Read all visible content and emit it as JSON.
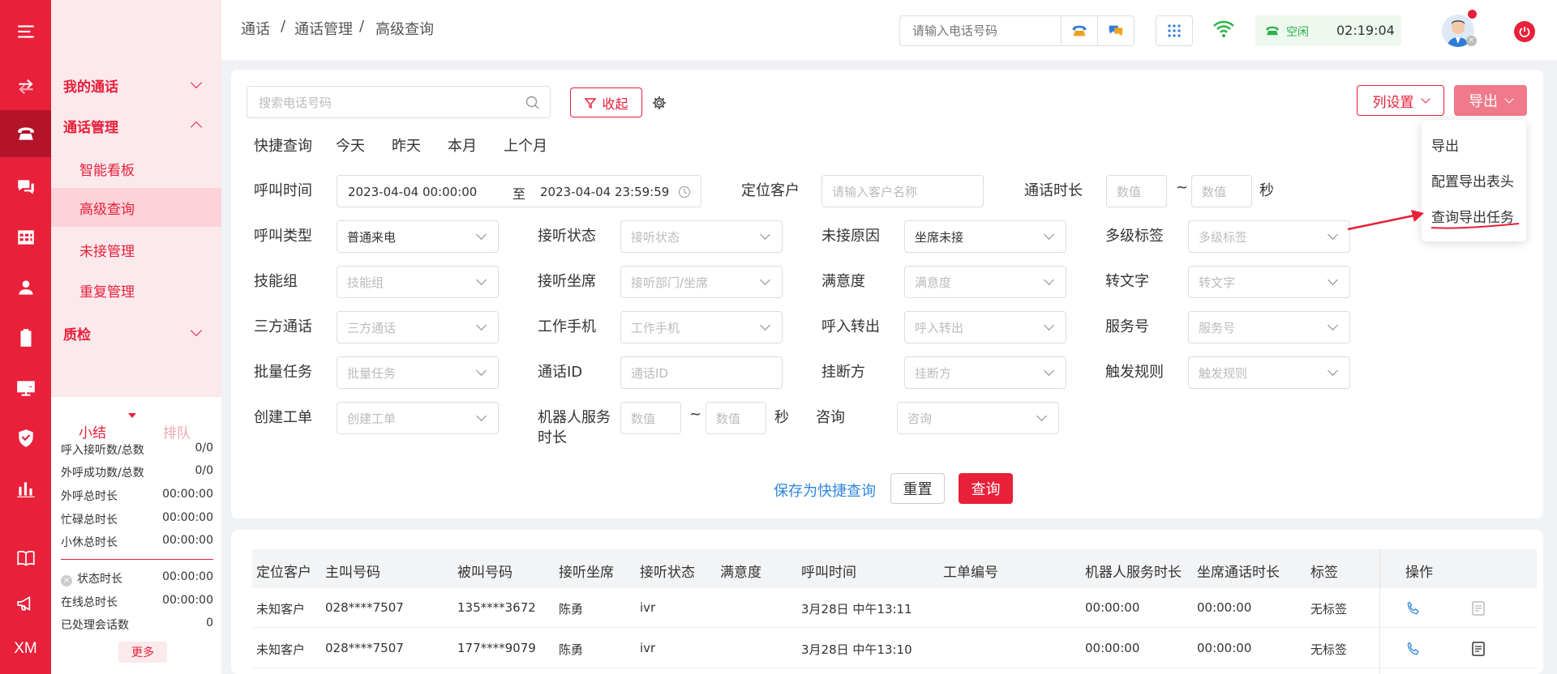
{
  "app": {
    "accent": "#e8203a"
  },
  "rail": {
    "bottom_text": "XM"
  },
  "menu": {
    "groups": [
      {
        "label": "我的通话"
      },
      {
        "label": "通话管理"
      },
      {
        "label": "质检"
      }
    ],
    "subs": [
      {
        "label": "智能看板"
      },
      {
        "label": "高级查询"
      },
      {
        "label": "未接管理"
      },
      {
        "label": "重复管理"
      }
    ]
  },
  "summary": {
    "tabs": [
      "小结",
      "排队"
    ],
    "rows": [
      {
        "label": "呼入接听数/总数",
        "value": "0/0"
      },
      {
        "label": "外呼成功数/总数",
        "value": "0/0"
      },
      {
        "label": "外呼总时长",
        "value": "00:00:00"
      },
      {
        "label": "忙碌总时长",
        "value": "00:00:00"
      },
      {
        "label": "小休总时长",
        "value": "00:00:00"
      },
      {
        "label": "状态时长",
        "value": "00:00:00"
      },
      {
        "label": "在线总时长",
        "value": "00:00:00"
      },
      {
        "label": "已处理会话数",
        "value": "0"
      }
    ],
    "more": "更多"
  },
  "header": {
    "breadcrumb": [
      "通话",
      "/",
      "通话管理",
      "/",
      "高级查询"
    ],
    "phone_placeholder": "请输入电话号码",
    "status_label": "空闲",
    "status_time": "02:19:04"
  },
  "filter": {
    "search_placeholder": "搜索电话号码",
    "collapse_label": "收起",
    "column_settings": "列设置",
    "export": "导出",
    "quick_label": "快捷查询",
    "quick_items": [
      "今天",
      "昨天",
      "本月",
      "上个月"
    ],
    "call_time_label": "呼叫时间",
    "date_from": "2023-04-04 00:00:00",
    "date_to_word": "至",
    "date_to": "2023-04-04 23:59:59",
    "locate_customer_label": "定位客户",
    "locate_customer_placeholder": "请输入客户名称",
    "duration_label": "通话时长",
    "num_placeholder": "数值",
    "tilde": "~",
    "sec": "秒",
    "fields": [
      {
        "label": "呼叫类型",
        "value": "普通来电",
        "has": true
      },
      {
        "label": "接听状态",
        "value": "接听状态"
      },
      {
        "label": "未接原因",
        "value": "坐席未接",
        "has": true
      },
      {
        "label": "多级标签",
        "value": "多级标签"
      },
      {
        "label": "技能组",
        "value": "技能组"
      },
      {
        "label": "接听坐席",
        "value": "接听部门/坐席"
      },
      {
        "label": "满意度",
        "value": "满意度"
      },
      {
        "label": "转文字",
        "value": "转文字"
      },
      {
        "label": "三方通话",
        "value": "三方通话"
      },
      {
        "label": "工作手机",
        "value": "工作手机"
      },
      {
        "label": "呼入转出",
        "value": "呼入转出"
      },
      {
        "label": "服务号",
        "value": "服务号"
      },
      {
        "label": "批量任务",
        "value": "批量任务"
      },
      {
        "label": "通话ID",
        "value": "通话ID"
      },
      {
        "label": "挂断方",
        "value": "挂断方"
      },
      {
        "label": "触发规则",
        "value": "触发规则"
      },
      {
        "label": "创建工单",
        "value": "创建工单"
      }
    ],
    "robot_label_1": "机器人服务",
    "robot_label_2": "时长",
    "consult_label": "咨询",
    "consult_placeholder": "咨询",
    "save_quick": "保存为快捷查询",
    "reset": "重置",
    "query": "查询"
  },
  "export_menu": {
    "items": [
      "导出",
      "配置导出表头",
      "查询导出任务"
    ]
  },
  "table": {
    "headers": [
      "定位客户",
      "主叫号码",
      "被叫号码",
      "接听坐席",
      "接听状态",
      "满意度",
      "呼叫时间",
      "工单编号",
      "机器人服务时长",
      "坐席通话时长",
      "标签",
      "操作"
    ],
    "rows": [
      [
        "未知客户",
        "028****7507",
        "135****3672",
        "陈勇",
        "ivr",
        "",
        "3月28日 中午13:11",
        "",
        "00:00:00",
        "00:00:00",
        "无标签"
      ],
      [
        "未知客户",
        "028****7507",
        "177****9079",
        "陈勇",
        "ivr",
        "",
        "3月28日 中午13:10",
        "",
        "00:00:00",
        "00:00:00",
        "无标签"
      ]
    ]
  }
}
